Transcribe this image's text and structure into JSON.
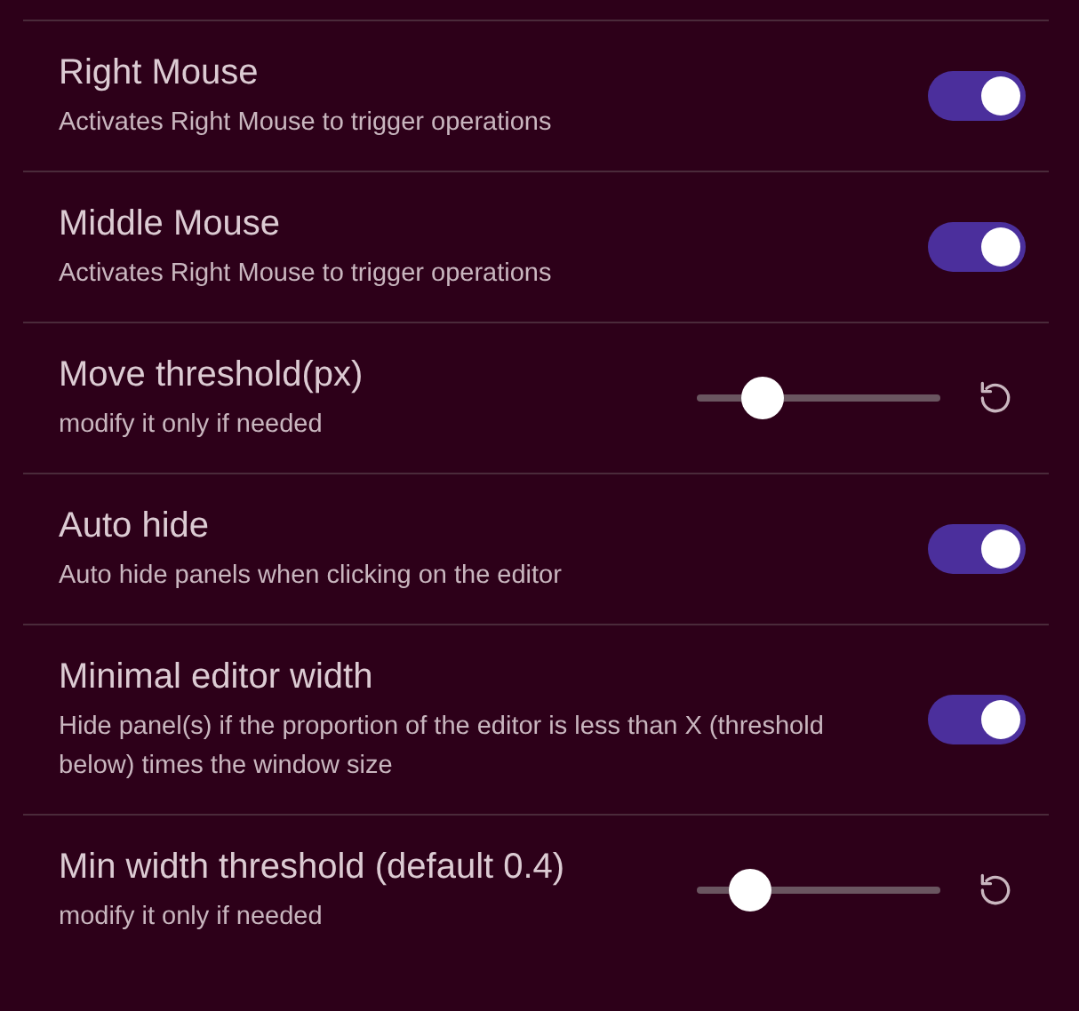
{
  "settings": [
    {
      "kind": "toggle",
      "title": "Right Mouse",
      "description": "Activates Right Mouse to trigger operations",
      "on": true
    },
    {
      "kind": "toggle",
      "title": "Middle Mouse",
      "description": "Activates Right Mouse to trigger operations",
      "on": true
    },
    {
      "kind": "slider",
      "title": "Move threshold(px)",
      "description": "modify it only if needed",
      "level": 0.27
    },
    {
      "kind": "toggle",
      "title": "Auto hide",
      "description": "Auto hide panels when clicking on the editor",
      "on": true
    },
    {
      "kind": "toggle",
      "title": "Minimal editor width",
      "description": "Hide panel(s) if the proportion of the editor is less than X (threshold below) times the window size",
      "on": true
    },
    {
      "kind": "slider",
      "title": "Min width threshold (default 0.4)",
      "description": "modify it only if needed",
      "level": 0.22
    }
  ]
}
